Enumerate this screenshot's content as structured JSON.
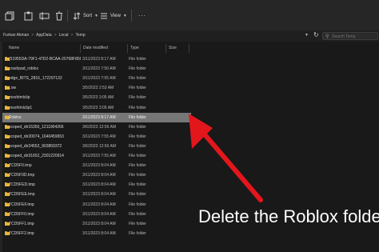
{
  "toolbar": {
    "sort_label": "Sort",
    "view_label": "View",
    "more_label": "..."
  },
  "address": {
    "crumbs": [
      "Furkan Akman",
      "AppData",
      "Local",
      "Temp"
    ],
    "separator": ">",
    "search_placeholder": "Search Temp"
  },
  "columns": {
    "name": "Name",
    "date": "Date modified",
    "type": "Type",
    "size": "Size"
  },
  "files": [
    {
      "name": "{51955DA-79F1-47D2-BCAA-20768F856...",
      "date": "3/11/2023 8:17 AM",
      "type": "File folder",
      "icon": "folder-icon"
    },
    {
      "name": "crashpad_roblox",
      "date": "3/11/2023 7:50 AM",
      "type": "File folder",
      "icon": "folder-icon"
    },
    {
      "name": "edge_BITS_2816_172297132",
      "date": "3/11/2023 7:55 AM",
      "type": "File folder",
      "icon": "folder-icon"
    },
    {
      "name": "Low",
      "date": "3/5/2023 2:53 AM",
      "type": "File folder",
      "icon": "folder-icon"
    },
    {
      "name": "msohtmlclip",
      "date": "3/5/2023 3:05 AM",
      "type": "File folder",
      "icon": "folder-icon"
    },
    {
      "name": "msohtmlclip1",
      "date": "3/5/2023 3:05 AM",
      "type": "File folder",
      "icon": "folder-icon"
    },
    {
      "name": "Roblox",
      "date": "3/11/2023 8:17 AM",
      "type": "File folder",
      "icon": "folder-icon",
      "selected": true
    },
    {
      "name": "scoped_dir15356_1211904266",
      "date": "3/6/2023 12:56 AM",
      "type": "File folder",
      "icon": "folder-icon"
    },
    {
      "name": "scoped_dir20074_1640459653",
      "date": "3/11/2023 7:55 AM",
      "type": "File folder",
      "icon": "folder-icon"
    },
    {
      "name": "scoped_dir24552_903859372",
      "date": "3/6/2023 12:56 AM",
      "type": "File folder",
      "icon": "folder-icon"
    },
    {
      "name": "scoped_dir31652_2301220914",
      "date": "3/11/2023 7:55 AM",
      "type": "File folder",
      "icon": "folder-icon"
    },
    {
      "name": "TCD5F0.tmp",
      "date": "3/11/2023 8:04 AM",
      "type": "File folder",
      "icon": "folder-icon"
    },
    {
      "name": "TCD5F0D.tmp",
      "date": "3/11/2023 8:04 AM",
      "type": "File folder",
      "icon": "folder-icon"
    },
    {
      "name": "TCD5FED.tmp",
      "date": "3/11/2023 8:04 AM",
      "type": "File folder",
      "icon": "folder-icon"
    },
    {
      "name": "TCD5FEE.tmp",
      "date": "3/11/2023 8:04 AM",
      "type": "File folder",
      "icon": "folder-icon"
    },
    {
      "name": "TCD5FEF.tmp",
      "date": "3/11/2023 8:04 AM",
      "type": "File folder",
      "icon": "folder-icon"
    },
    {
      "name": "TCD5FF0.tmp",
      "date": "3/11/2023 8:04 AM",
      "type": "File folder",
      "icon": "folder-icon"
    },
    {
      "name": "TCD5FF1.tmp",
      "date": "3/11/2023 8:04 AM",
      "type": "File folder",
      "icon": "folder-icon"
    },
    {
      "name": "TCD5FF2.tmp",
      "date": "3/11/2023 8:04 AM",
      "type": "File folder",
      "icon": "folder-icon"
    }
  ],
  "annotation": {
    "caption": "Delete the Roblox folde",
    "arrow_color": "#e3161c"
  },
  "colors": {
    "folder": "#e8b53c",
    "folder_tab": "#c99628",
    "selected_row": "#777777",
    "toolbar_bg": "#262626",
    "window_bg": "#191919"
  }
}
